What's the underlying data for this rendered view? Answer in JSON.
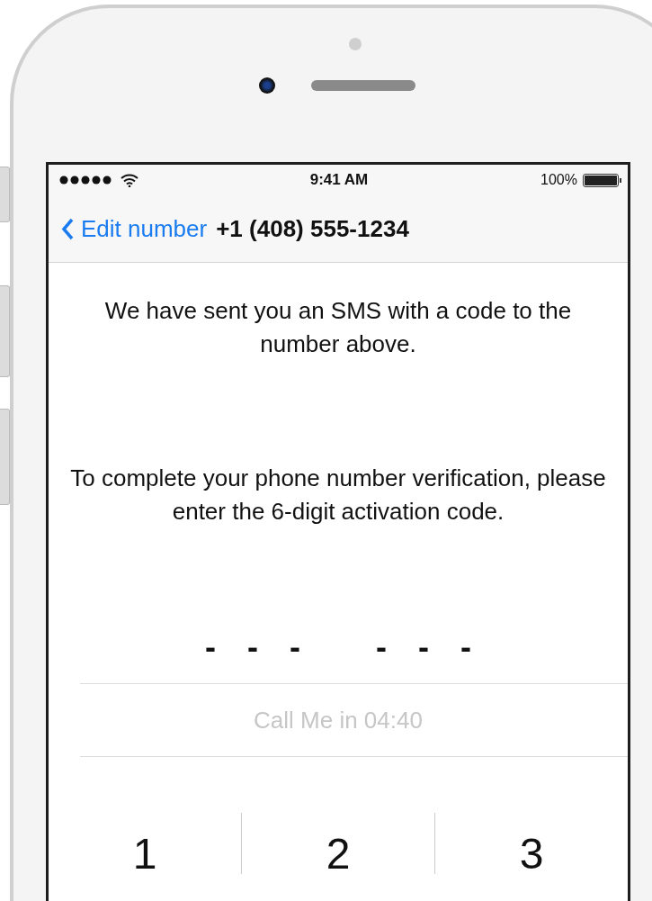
{
  "status_bar": {
    "time": "9:41 AM",
    "battery": "100%"
  },
  "nav_bar": {
    "back_label": "Edit number",
    "title": "+1 (408) 555-1234"
  },
  "messages": [
    "We have sent you an SMS with a code to the number above.",
    "To complete your phone number verification, please enter the 6-digit activation code."
  ],
  "code_fields": [
    {
      "placeholder": "-"
    },
    {
      "placeholder": "-"
    },
    {
      "placeholder": "-"
    },
    {
      "placeholder": "-"
    },
    {
      "placeholder": "-"
    },
    {
      "placeholder": "-"
    }
  ],
  "call_me": {
    "label": "Call Me in 04:40",
    "disabled": true
  },
  "keypad": [
    "1",
    "2",
    "3"
  ]
}
